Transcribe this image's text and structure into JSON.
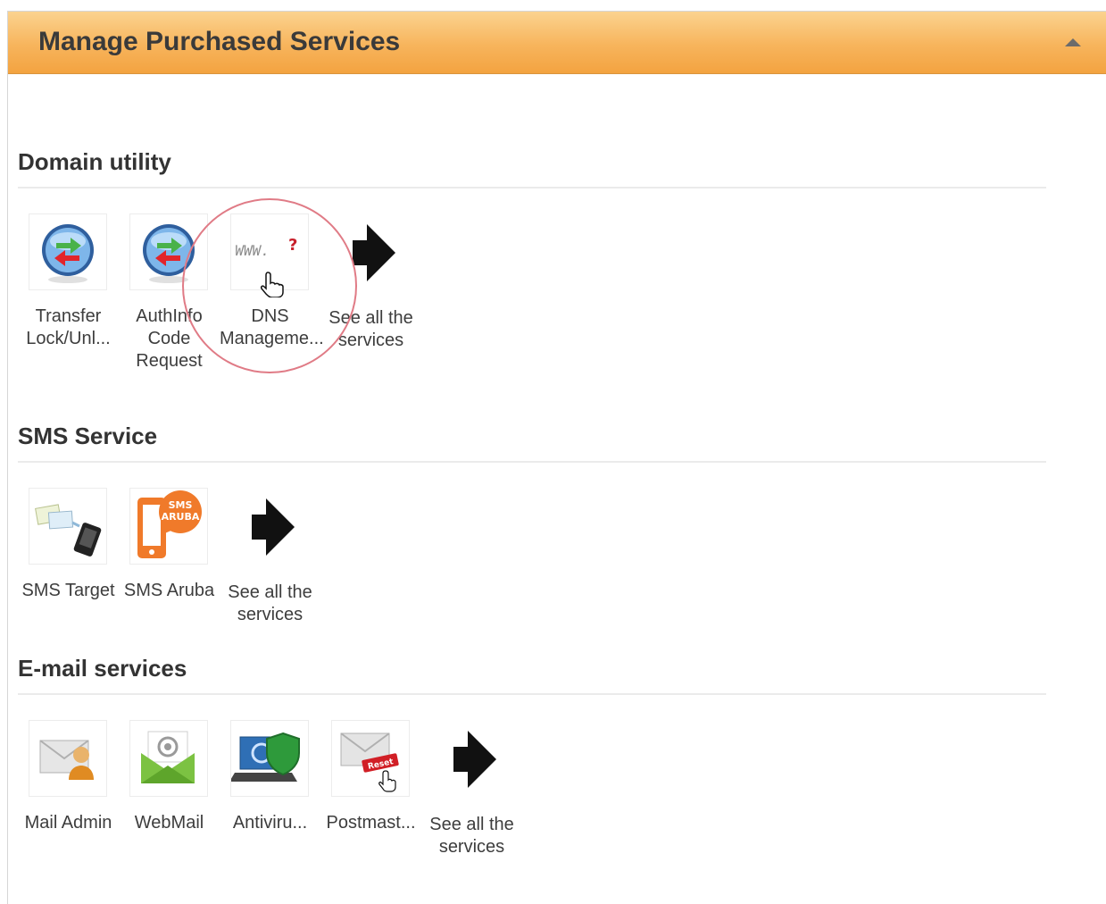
{
  "panel": {
    "title": "Manage Purchased Services"
  },
  "sections": {
    "domain": {
      "title": "Domain utility",
      "items": [
        {
          "label": "Transfer Lock/Unl..."
        },
        {
          "label": "AuthInfo Code Request"
        },
        {
          "label": "DNS Manageme..."
        }
      ],
      "see_all": "See all the services"
    },
    "sms": {
      "title": "SMS Service",
      "items": [
        {
          "label": "SMS Target"
        },
        {
          "label": "SMS Aruba",
          "badge_line1": "SMS",
          "badge_line2": "ARUBA"
        }
      ],
      "see_all": "See all the services"
    },
    "email": {
      "title": "E-mail services",
      "items": [
        {
          "label": "Mail Admin"
        },
        {
          "label": "WebMail"
        },
        {
          "label": "Antiviru..."
        },
        {
          "label": "Postmast...",
          "badge": "Reset"
        }
      ],
      "see_all": "See all the services"
    }
  },
  "icons": {
    "www_text": "WWW.",
    "question_mark": "?"
  }
}
